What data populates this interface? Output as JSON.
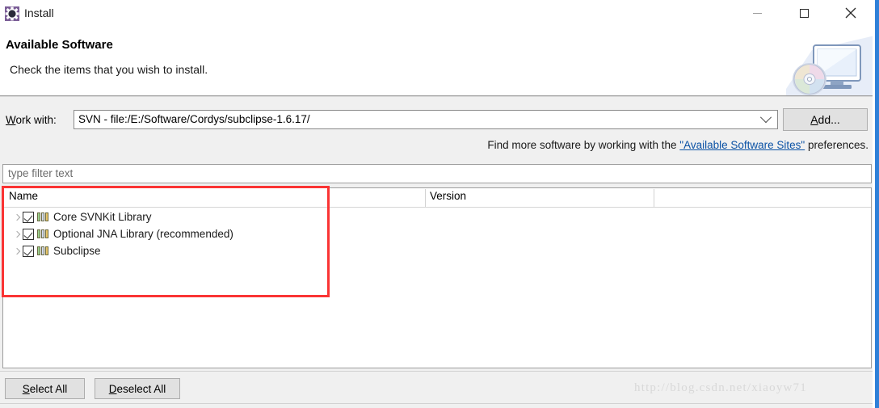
{
  "window": {
    "title": "Install",
    "icon": "install-gear-icon",
    "controls": {
      "minimize": "minimize-icon",
      "maximize": "maximize-icon",
      "close": "close-icon"
    }
  },
  "header": {
    "title": "Available Software",
    "subtitle": "Check the items that you wish to install.",
    "banner_icon": "computer-cd-icon"
  },
  "work_with": {
    "label_mnemonic": "W",
    "label_rest": "ork with:",
    "value": "SVN - file:/E:/Software/Cordys/subclipse-1.6.17/",
    "dropdown_icon": "chevron-down-icon",
    "add_button": {
      "mnemonic": "A",
      "rest": "dd..."
    }
  },
  "find_more": {
    "prefix": "Find more software by working with the ",
    "link": "\"Available Software Sites\"",
    "suffix": " preferences."
  },
  "filter": {
    "placeholder": "type filter text",
    "value": ""
  },
  "tree": {
    "columns": [
      {
        "label": "Name"
      },
      {
        "label": "Version"
      }
    ],
    "rows": [
      {
        "label": "Core SVNKit Library",
        "checked": true,
        "expandable": true,
        "version": "",
        "icon": "feature-bars-icon"
      },
      {
        "label": "Optional JNA Library (recommended)",
        "checked": true,
        "expandable": true,
        "version": "",
        "icon": "feature-bars-icon"
      },
      {
        "label": "Subclipse",
        "checked": true,
        "expandable": true,
        "version": "",
        "icon": "feature-bars-icon"
      }
    ]
  },
  "footer": {
    "select_all": {
      "mnemonic": "S",
      "rest": "elect All"
    },
    "deselect_all": {
      "mnemonic": "D",
      "rest": "eselect All"
    }
  },
  "watermark": "http://blog.csdn.net/xiaoyw71",
  "colors": {
    "annotation_red": "#fa3434",
    "link_blue": "#0b52a5",
    "dialog_bg": "#f0f0f0",
    "content_bg": "#ffffff",
    "button_bg": "#e1e1e1"
  }
}
